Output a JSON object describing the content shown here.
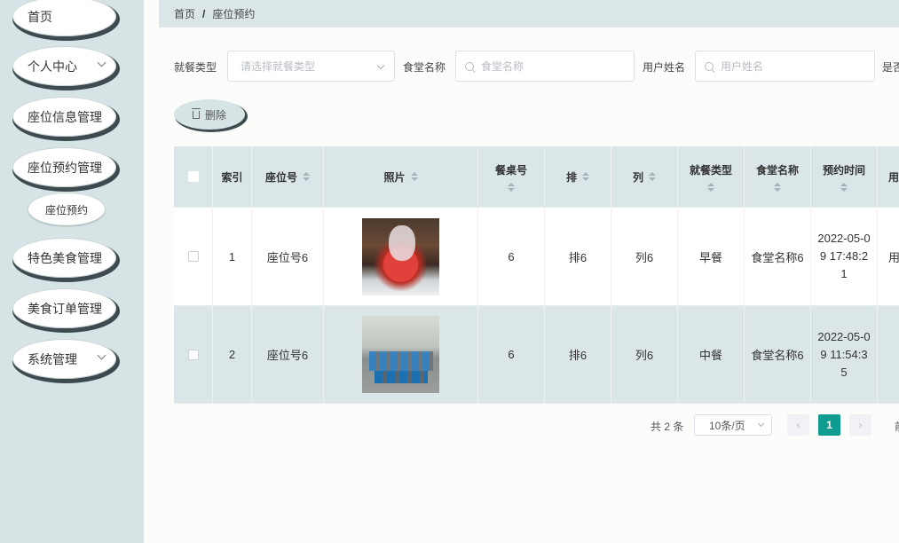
{
  "sidebar": {
    "items": [
      {
        "label": "首页",
        "has_arrow": false
      },
      {
        "label": "个人中心",
        "has_arrow": true
      },
      {
        "label": "座位信息管理",
        "has_arrow": false
      },
      {
        "label": "座位预约管理",
        "has_arrow": false
      },
      {
        "label": "特色美食管理",
        "has_arrow": false
      },
      {
        "label": "美食订单管理",
        "has_arrow": false
      },
      {
        "label": "系统管理",
        "has_arrow": true
      }
    ],
    "subitem": "座位预约"
  },
  "breadcrumb": {
    "home": "首页",
    "sep": "/",
    "current": "座位预约"
  },
  "filters": {
    "meal_type_label": "就餐类型",
    "meal_type_placeholder": "请选择就餐类型",
    "canteen_label": "食堂名称",
    "canteen_placeholder": "食堂名称",
    "user_label": "用户姓名",
    "user_placeholder": "用户姓名",
    "extra_label_cut": "是否"
  },
  "actions": {
    "delete_label": "删除"
  },
  "table": {
    "headers": {
      "index": "索引",
      "seat_no": "座位号",
      "photo": "照片",
      "table_no": "餐桌号",
      "row": "排",
      "col": "列",
      "meal_type": "就餐类型",
      "canteen": "食堂名称",
      "time": "预约时间",
      "user_cut": "用"
    },
    "rows": [
      {
        "index": "1",
        "seat_no": "座位号6",
        "photo": "food-photo",
        "table_no": "6",
        "row": "排6",
        "col": "列6",
        "meal_type": "早餐",
        "canteen": "食堂名称6",
        "time": "2022-05-09 17:48:21",
        "user_cut": "用"
      },
      {
        "index": "2",
        "seat_no": "座位号6",
        "photo": "canteen-photo",
        "table_no": "6",
        "row": "排6",
        "col": "列6",
        "meal_type": "中餐",
        "canteen": "食堂名称6",
        "time": "2022-05-09 11:54:35",
        "user_cut": ""
      }
    ]
  },
  "pagination": {
    "total": "共 2 条",
    "page_size": "10条/页",
    "prev": "‹",
    "current": "1",
    "next": "›",
    "goto_cut": "前"
  },
  "colors": {
    "accent": "#0d9c8f",
    "sidebar_bg": "#d6e4e6",
    "header_bg": "#dbe6e8"
  }
}
